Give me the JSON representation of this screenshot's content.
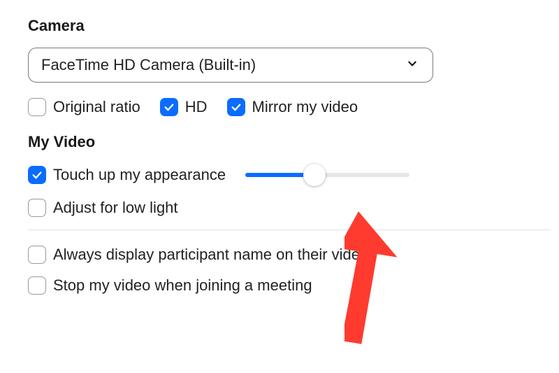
{
  "sections": {
    "camera": {
      "title": "Camera",
      "device_selected": "FaceTime HD Camera (Built-in)",
      "options": {
        "original_ratio": {
          "label": "Original ratio",
          "checked": false
        },
        "hd": {
          "label": "HD",
          "checked": true
        },
        "mirror": {
          "label": "Mirror my video",
          "checked": true
        }
      }
    },
    "my_video": {
      "title": "My Video",
      "touch_up": {
        "label": "Touch up my appearance",
        "checked": true,
        "slider_percent": 42
      },
      "low_light": {
        "label": "Adjust for low light",
        "checked": false
      },
      "always_name": {
        "label": "Always display participant name on their video",
        "checked": false
      },
      "stop_on_join": {
        "label": "Stop my video when joining a meeting",
        "checked": false
      }
    }
  },
  "colors": {
    "accent": "#0b6cff",
    "arrow": "#ff3b2f"
  }
}
